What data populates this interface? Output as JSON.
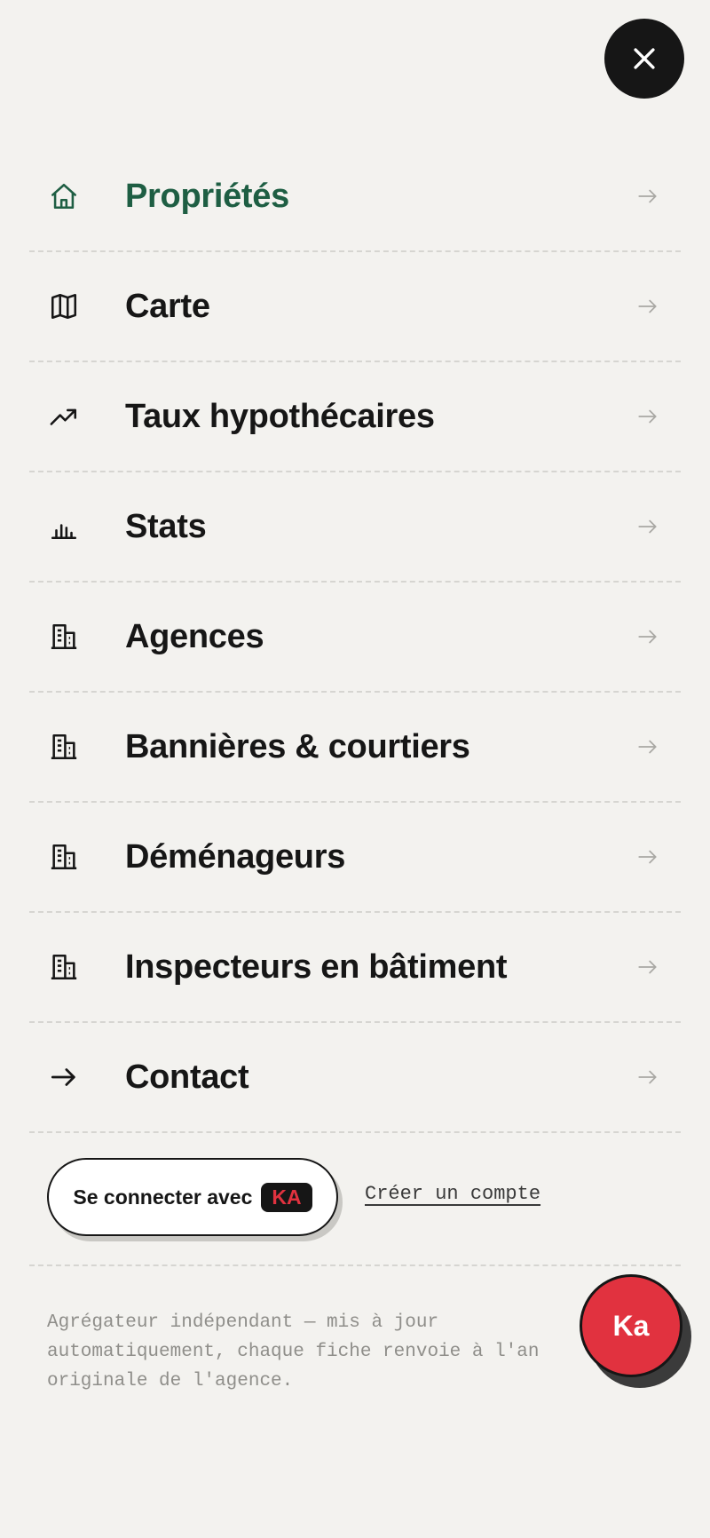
{
  "colors": {
    "background": "#f3f2ef",
    "text": "#161616",
    "active": "#1e5e43",
    "accent": "#e1323f",
    "muted": "#8f8e8a"
  },
  "close_button": {
    "icon": "close-icon"
  },
  "menu": {
    "items": [
      {
        "label": "Propriétés",
        "icon": "home-icon",
        "active": true
      },
      {
        "label": "Carte",
        "icon": "map-icon"
      },
      {
        "label": "Taux hypothécaires",
        "icon": "trending-up-icon"
      },
      {
        "label": "Stats",
        "icon": "bar-chart-icon"
      },
      {
        "label": "Agences",
        "icon": "building-icon"
      },
      {
        "label": "Bannières & courtiers",
        "icon": "building-icon"
      },
      {
        "label": "Déménageurs",
        "icon": "building-icon"
      },
      {
        "label": "Inspecteurs en bâtiment",
        "icon": "building-icon"
      },
      {
        "label": "Contact",
        "icon": "arrow-right-icon"
      }
    ]
  },
  "auth": {
    "connect_label": "Se connecter avec",
    "connect_badge": "KA",
    "create_account": "Créer un compte"
  },
  "footer": {
    "text": "Agrégateur indépendant — mis à jour\nautomatiquement, chaque fiche renvoie à l'an\noriginale de l'agence."
  },
  "fab": {
    "label": "Ka"
  }
}
